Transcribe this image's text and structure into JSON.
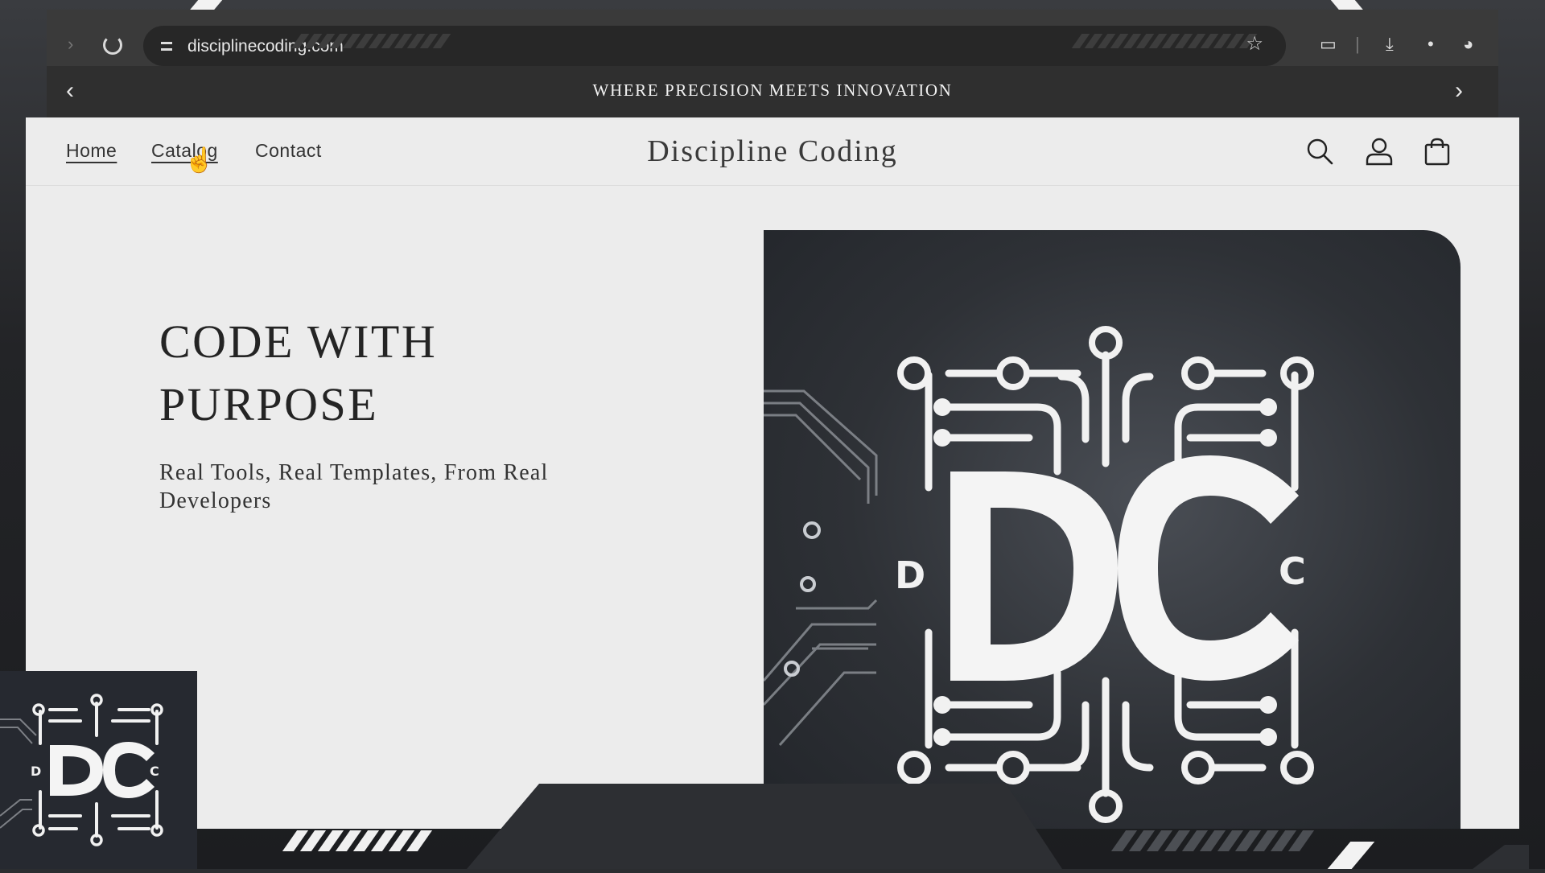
{
  "browser": {
    "url": "disciplinecoding.com"
  },
  "announcement": {
    "text": "WHERE PRECISION MEETS INNOVATION"
  },
  "header": {
    "brand": "Discipline Coding",
    "nav": [
      {
        "label": "Home"
      },
      {
        "label": "Catalog"
      },
      {
        "label": "Contact"
      }
    ]
  },
  "hero": {
    "title_line1": "CODE WITH",
    "title_line2": "PURPOSE",
    "subtitle": "Real Tools, Real Templates, From Real Developers",
    "logo_letters": {
      "big_d": "D",
      "big_c": "C",
      "small_d": "D",
      "small_c": "C"
    }
  },
  "icons": {
    "search": "search-icon",
    "account": "user-icon",
    "cart": "bag-icon",
    "star": "star-icon",
    "reload": "reload-icon"
  },
  "colors": {
    "page_bg": "#ececec",
    "announcement_bg": "#2f2f2f",
    "frame_bg": "#2b2d30",
    "text": "#242424"
  }
}
